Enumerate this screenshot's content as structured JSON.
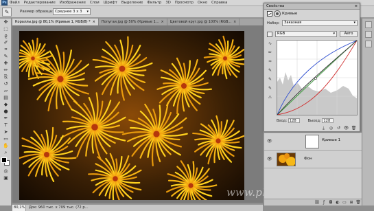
{
  "menu": {
    "logo": "Ps",
    "items": [
      "Файл",
      "Редактирование",
      "Изображение",
      "Слои",
      "Шрифт",
      "Выделение",
      "Фильтр",
      "3D",
      "Просмотр",
      "Окно",
      "Справка"
    ]
  },
  "options": {
    "sample_label": "Размер образца:",
    "sample_value": "Среднее 3 x 3"
  },
  "tabs": [
    {
      "label": "Кораллы.jpg @ 80,1% (Кривые 1, RGB/8) *",
      "active": true
    },
    {
      "label": "Попугаи.jpg @ 50% (Кривые 1...",
      "active": false
    },
    {
      "label": "Цветовой круг.jpg @ 100% (RGB...",
      "active": false
    }
  ],
  "tools": [
    "move",
    "marquee",
    "lasso",
    "quick-select",
    "crop",
    "eyedropper",
    "healing",
    "brush",
    "clone",
    "history",
    "eraser",
    "gradient",
    "blur",
    "dodge",
    "pen",
    "type",
    "path-select",
    "shape",
    "hand",
    "zoom"
  ],
  "status": {
    "zoom": "80,1%",
    "doc": "Док: 960 тыс. х 709 тыс. (72 р..."
  },
  "properties": {
    "title": "Свойства",
    "adjustment": "Кривые",
    "preset_label": "Набор:",
    "preset_value": "Заказная",
    "channel": "RGB",
    "auto": "Авто",
    "input_label": "Вход:",
    "input_value": "128",
    "output_label": "Выход:",
    "output_value": "128"
  },
  "layers": {
    "items": [
      {
        "name": "Кривые 1",
        "selected": false
      },
      {
        "name": "Фон",
        "selected": false
      }
    ]
  },
  "watermark": "www.photoshopsunduchok.ru",
  "colors": {
    "accent": "#b0c4de",
    "panel": "#d4d4d4"
  }
}
